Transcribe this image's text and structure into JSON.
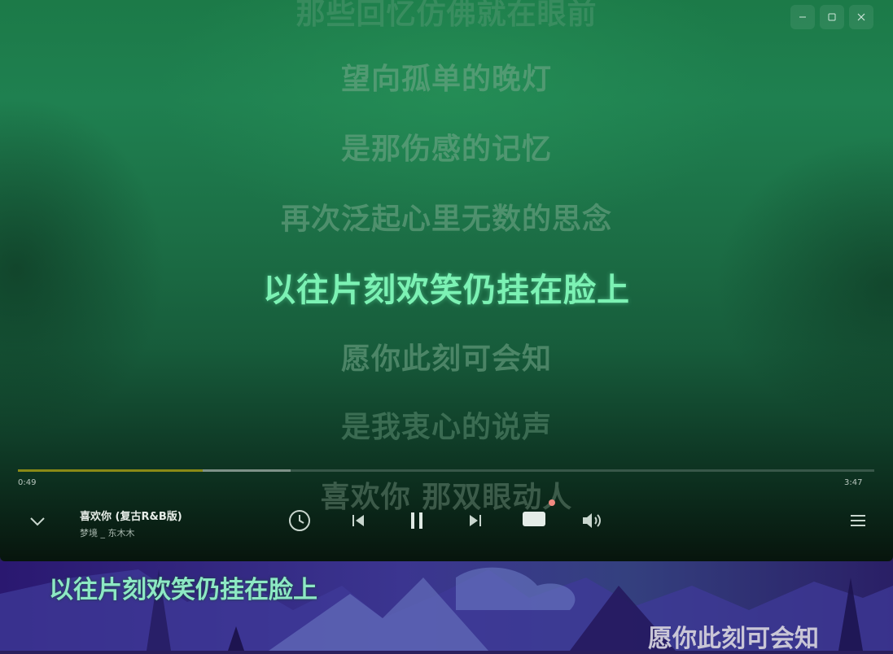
{
  "window": {
    "minimize_icon": "minimize-icon",
    "maximize_icon": "maximize-icon",
    "close_icon": "close-icon"
  },
  "lyrics": {
    "top_partial": "那些回忆仿佛就在眼前",
    "lines": [
      "望向孤单的晚灯",
      "是那伤感的记忆",
      "再次泛起心里无数的思念",
      "以往片刻欢笑仍挂在脸上",
      "愿你此刻可会知",
      "是我衷心的说声",
      "喜欢你 那双眼动人"
    ],
    "current_index": 3
  },
  "playback": {
    "current_time": "0:49",
    "total_time": "3:47",
    "progress": 0.216,
    "buffered": 0.318
  },
  "song": {
    "title": "喜欢你 (复古R&B版)",
    "artist": "梦境 _ 东木木"
  },
  "controls": {
    "collapse_icon": "chevron-down-icon",
    "history_icon": "clock-icon",
    "prev_icon": "skip-previous-icon",
    "pause_icon": "pause-icon",
    "next_icon": "skip-next-icon",
    "lyrics_icon": "desktop-lyrics-icon",
    "volume_icon": "volume-icon",
    "playlist_icon": "playlist-icon"
  },
  "desktop_lyrics": {
    "line1": "以往片刻欢笑仍挂在脸上",
    "line2": "愿你此刻可会知"
  },
  "colors": {
    "current_lyric": "#7cf2b4",
    "progress_played": "#8a8a16",
    "lyrics_dot": "#f08a80"
  }
}
